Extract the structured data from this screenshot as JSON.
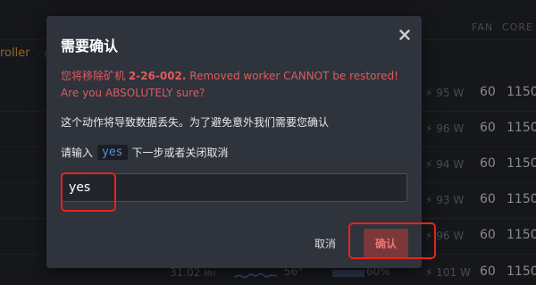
{
  "background": {
    "columns": {
      "fan": "FAN",
      "core": "CORE"
    },
    "sidebar_fragment": "roller",
    "sidebar_fragment_dim": "· In",
    "rows": [
      {
        "power": "95 W",
        "fan": "60",
        "core": "1150"
      },
      {
        "power": "96 W",
        "fan": "60",
        "core": "1150"
      },
      {
        "power": "94 W",
        "fan": "60",
        "core": "1150"
      },
      {
        "power": "93 W",
        "fan": "60",
        "core": "1150"
      },
      {
        "power": "96 W",
        "fan": "60",
        "core": "1150"
      }
    ],
    "bottom_row": {
      "hashrate": "31.02",
      "hashrate_unit": "MH",
      "temp": "56°",
      "utilization": "60%",
      "power": "101 W",
      "fan": "60",
      "core": "1150"
    }
  },
  "modal": {
    "title": "需要确认",
    "warning_prefix": "您将移除矿机 ",
    "worker_name": "2-26-002.",
    "warning_suffix": " Removed worker CANNOT be restored! Are you ABSOLUTELY sure?",
    "body": "这个动作将导致数据丢失。为了避免意外我们需要您确认",
    "prompt_prefix": "请输入",
    "prompt_code": "yes",
    "prompt_suffix": "下一步或者关闭取消",
    "input_value": "yes",
    "cancel_label": "取消",
    "confirm_label": "确认"
  },
  "colors": {
    "warning": "#e05a5c",
    "confirm_bg": "#7a3838",
    "highlight": "#e8221b"
  }
}
